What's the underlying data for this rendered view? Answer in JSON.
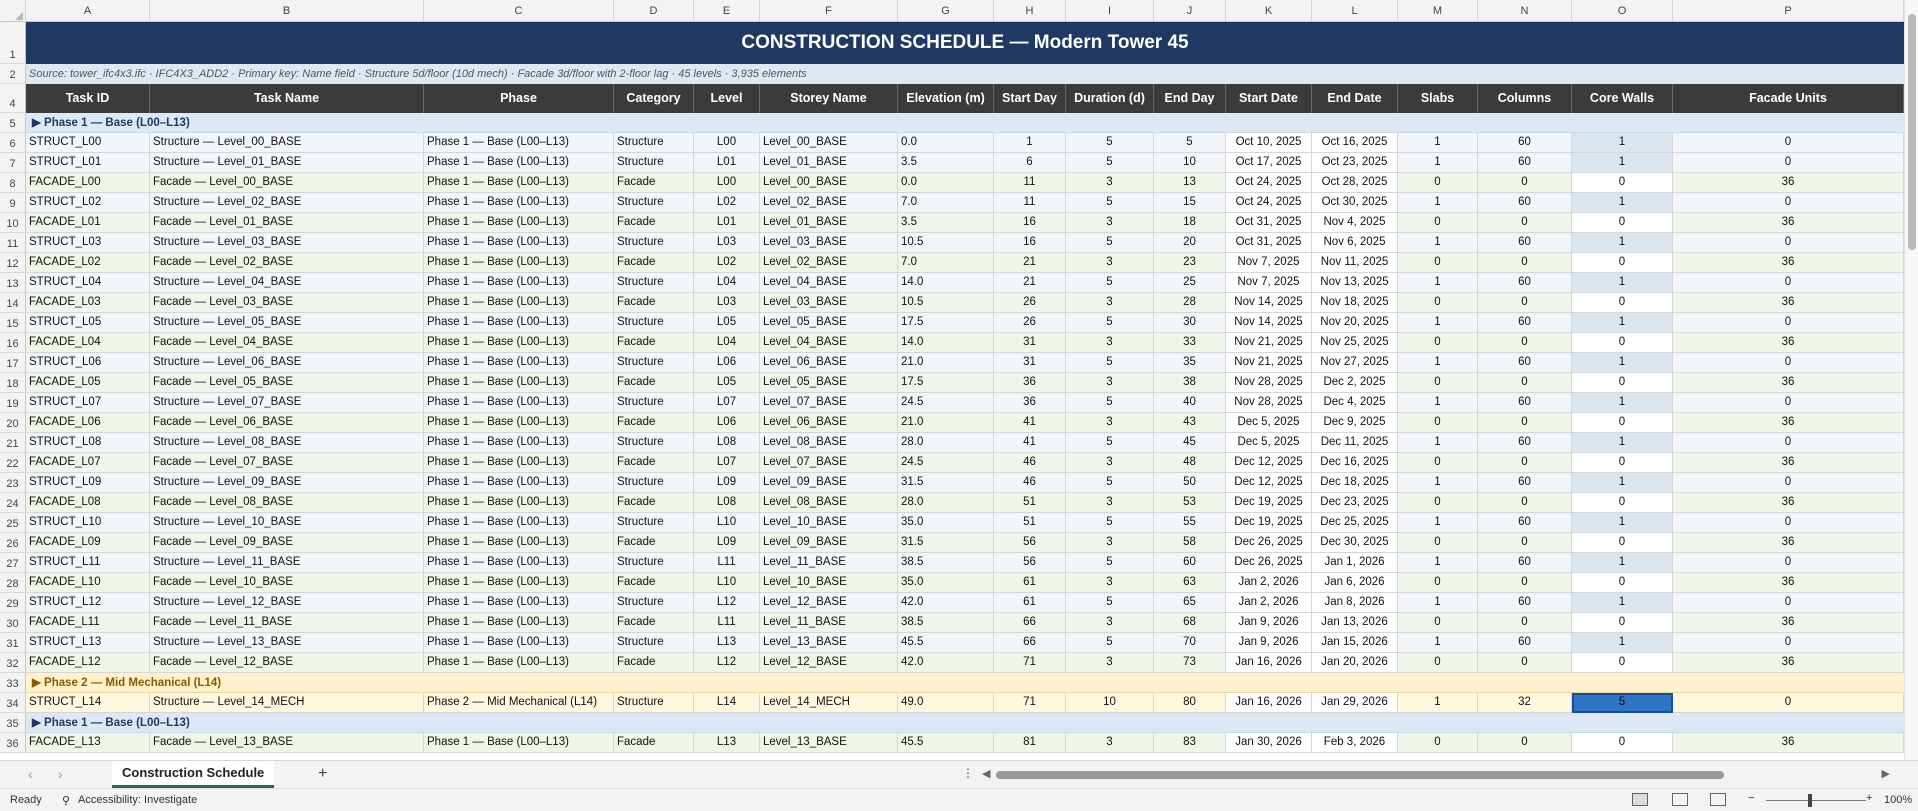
{
  "columns": [
    "A",
    "B",
    "C",
    "D",
    "E",
    "F",
    "G",
    "H",
    "I",
    "J",
    "K",
    "L",
    "M",
    "N",
    "O",
    "P"
  ],
  "title": "CONSTRUCTION SCHEDULE  —  Modern Tower 45",
  "source_line": "Source: tower_ifc4x3.ifc  ·  IFC4X3_ADD2  ·  Primary key: Name field  ·  Structure 5d/floor (10d mech)  ·  Facade 3d/floor with 2-floor lag  ·  45 levels · 3,935 elements",
  "headers": [
    "Task ID",
    "Task Name",
    "Phase",
    "Category",
    "Level",
    "Storey Name",
    "Elevation (m)",
    "Start Day",
    "Duration (d)",
    "End Day",
    "Start Date",
    "End Date",
    "Slabs",
    "Columns",
    "Core Walls",
    "Facade Units"
  ],
  "rows": [
    {
      "n": "1",
      "kind": "title"
    },
    {
      "n": "2",
      "kind": "source"
    },
    {
      "n": "4",
      "kind": "header"
    },
    {
      "n": "5",
      "kind": "phase",
      "cls": "ph1",
      "label": "▶  Phase 1 — Base (L00–L13)"
    },
    {
      "n": "6",
      "kind": "data",
      "cat": "st",
      "cells": [
        "STRUCT_L00",
        "Structure — Level_00_BASE",
        "Phase 1 — Base (L00–L13)",
        "Structure",
        "L00",
        "Level_00_BASE",
        "0.0",
        "1",
        "5",
        "5",
        "Oct 10, 2025",
        "Oct 16, 2025",
        "1",
        "60",
        "1",
        "0"
      ]
    },
    {
      "n": "7",
      "kind": "data",
      "cat": "st",
      "cells": [
        "STRUCT_L01",
        "Structure — Level_01_BASE",
        "Phase 1 — Base (L00–L13)",
        "Structure",
        "L01",
        "Level_01_BASE",
        "3.5",
        "6",
        "5",
        "10",
        "Oct 17, 2025",
        "Oct 23, 2025",
        "1",
        "60",
        "1",
        "0"
      ]
    },
    {
      "n": "8",
      "kind": "data",
      "cat": "fa",
      "cells": [
        "FACADE_L00",
        "Facade — Level_00_BASE",
        "Phase 1 — Base (L00–L13)",
        "Facade",
        "L00",
        "Level_00_BASE",
        "0.0",
        "11",
        "3",
        "13",
        "Oct 24, 2025",
        "Oct 28, 2025",
        "0",
        "0",
        "0",
        "36"
      ]
    },
    {
      "n": "9",
      "kind": "data",
      "cat": "st",
      "cells": [
        "STRUCT_L02",
        "Structure — Level_02_BASE",
        "Phase 1 — Base (L00–L13)",
        "Structure",
        "L02",
        "Level_02_BASE",
        "7.0",
        "11",
        "5",
        "15",
        "Oct 24, 2025",
        "Oct 30, 2025",
        "1",
        "60",
        "1",
        "0"
      ]
    },
    {
      "n": "10",
      "kind": "data",
      "cat": "fa",
      "cells": [
        "FACADE_L01",
        "Facade — Level_01_BASE",
        "Phase 1 — Base (L00–L13)",
        "Facade",
        "L01",
        "Level_01_BASE",
        "3.5",
        "16",
        "3",
        "18",
        "Oct 31, 2025",
        "Nov 4, 2025",
        "0",
        "0",
        "0",
        "36"
      ]
    },
    {
      "n": "11",
      "kind": "data",
      "cat": "st",
      "cells": [
        "STRUCT_L03",
        "Structure — Level_03_BASE",
        "Phase 1 — Base (L00–L13)",
        "Structure",
        "L03",
        "Level_03_BASE",
        "10.5",
        "16",
        "5",
        "20",
        "Oct 31, 2025",
        "Nov 6, 2025",
        "1",
        "60",
        "1",
        "0"
      ]
    },
    {
      "n": "12",
      "kind": "data",
      "cat": "fa",
      "cells": [
        "FACADE_L02",
        "Facade — Level_02_BASE",
        "Phase 1 — Base (L00–L13)",
        "Facade",
        "L02",
        "Level_02_BASE",
        "7.0",
        "21",
        "3",
        "23",
        "Nov 7, 2025",
        "Nov 11, 2025",
        "0",
        "0",
        "0",
        "36"
      ]
    },
    {
      "n": "13",
      "kind": "data",
      "cat": "st",
      "cells": [
        "STRUCT_L04",
        "Structure — Level_04_BASE",
        "Phase 1 — Base (L00–L13)",
        "Structure",
        "L04",
        "Level_04_BASE",
        "14.0",
        "21",
        "5",
        "25",
        "Nov 7, 2025",
        "Nov 13, 2025",
        "1",
        "60",
        "1",
        "0"
      ]
    },
    {
      "n": "14",
      "kind": "data",
      "cat": "fa",
      "cells": [
        "FACADE_L03",
        "Facade — Level_03_BASE",
        "Phase 1 — Base (L00–L13)",
        "Facade",
        "L03",
        "Level_03_BASE",
        "10.5",
        "26",
        "3",
        "28",
        "Nov 14, 2025",
        "Nov 18, 2025",
        "0",
        "0",
        "0",
        "36"
      ]
    },
    {
      "n": "15",
      "kind": "data",
      "cat": "st",
      "cells": [
        "STRUCT_L05",
        "Structure — Level_05_BASE",
        "Phase 1 — Base (L00–L13)",
        "Structure",
        "L05",
        "Level_05_BASE",
        "17.5",
        "26",
        "5",
        "30",
        "Nov 14, 2025",
        "Nov 20, 2025",
        "1",
        "60",
        "1",
        "0"
      ]
    },
    {
      "n": "16",
      "kind": "data",
      "cat": "fa",
      "cells": [
        "FACADE_L04",
        "Facade — Level_04_BASE",
        "Phase 1 — Base (L00–L13)",
        "Facade",
        "L04",
        "Level_04_BASE",
        "14.0",
        "31",
        "3",
        "33",
        "Nov 21, 2025",
        "Nov 25, 2025",
        "0",
        "0",
        "0",
        "36"
      ]
    },
    {
      "n": "17",
      "kind": "data",
      "cat": "st",
      "cells": [
        "STRUCT_L06",
        "Structure — Level_06_BASE",
        "Phase 1 — Base (L00–L13)",
        "Structure",
        "L06",
        "Level_06_BASE",
        "21.0",
        "31",
        "5",
        "35",
        "Nov 21, 2025",
        "Nov 27, 2025",
        "1",
        "60",
        "1",
        "0"
      ]
    },
    {
      "n": "18",
      "kind": "data",
      "cat": "fa",
      "cells": [
        "FACADE_L05",
        "Facade — Level_05_BASE",
        "Phase 1 — Base (L00–L13)",
        "Facade",
        "L05",
        "Level_05_BASE",
        "17.5",
        "36",
        "3",
        "38",
        "Nov 28, 2025",
        "Dec 2, 2025",
        "0",
        "0",
        "0",
        "36"
      ]
    },
    {
      "n": "19",
      "kind": "data",
      "cat": "st",
      "cells": [
        "STRUCT_L07",
        "Structure — Level_07_BASE",
        "Phase 1 — Base (L00–L13)",
        "Structure",
        "L07",
        "Level_07_BASE",
        "24.5",
        "36",
        "5",
        "40",
        "Nov 28, 2025",
        "Dec 4, 2025",
        "1",
        "60",
        "1",
        "0"
      ]
    },
    {
      "n": "20",
      "kind": "data",
      "cat": "fa",
      "cells": [
        "FACADE_L06",
        "Facade — Level_06_BASE",
        "Phase 1 — Base (L00–L13)",
        "Facade",
        "L06",
        "Level_06_BASE",
        "21.0",
        "41",
        "3",
        "43",
        "Dec 5, 2025",
        "Dec 9, 2025",
        "0",
        "0",
        "0",
        "36"
      ]
    },
    {
      "n": "21",
      "kind": "data",
      "cat": "st",
      "cells": [
        "STRUCT_L08",
        "Structure — Level_08_BASE",
        "Phase 1 — Base (L00–L13)",
        "Structure",
        "L08",
        "Level_08_BASE",
        "28.0",
        "41",
        "5",
        "45",
        "Dec 5, 2025",
        "Dec 11, 2025",
        "1",
        "60",
        "1",
        "0"
      ]
    },
    {
      "n": "22",
      "kind": "data",
      "cat": "fa",
      "cells": [
        "FACADE_L07",
        "Facade — Level_07_BASE",
        "Phase 1 — Base (L00–L13)",
        "Facade",
        "L07",
        "Level_07_BASE",
        "24.5",
        "46",
        "3",
        "48",
        "Dec 12, 2025",
        "Dec 16, 2025",
        "0",
        "0",
        "0",
        "36"
      ]
    },
    {
      "n": "23",
      "kind": "data",
      "cat": "st",
      "cells": [
        "STRUCT_L09",
        "Structure — Level_09_BASE",
        "Phase 1 — Base (L00–L13)",
        "Structure",
        "L09",
        "Level_09_BASE",
        "31.5",
        "46",
        "5",
        "50",
        "Dec 12, 2025",
        "Dec 18, 2025",
        "1",
        "60",
        "1",
        "0"
      ]
    },
    {
      "n": "24",
      "kind": "data",
      "cat": "fa",
      "cells": [
        "FACADE_L08",
        "Facade — Level_08_BASE",
        "Phase 1 — Base (L00–L13)",
        "Facade",
        "L08",
        "Level_08_BASE",
        "28.0",
        "51",
        "3",
        "53",
        "Dec 19, 2025",
        "Dec 23, 2025",
        "0",
        "0",
        "0",
        "36"
      ]
    },
    {
      "n": "25",
      "kind": "data",
      "cat": "st",
      "cells": [
        "STRUCT_L10",
        "Structure — Level_10_BASE",
        "Phase 1 — Base (L00–L13)",
        "Structure",
        "L10",
        "Level_10_BASE",
        "35.0",
        "51",
        "5",
        "55",
        "Dec 19, 2025",
        "Dec 25, 2025",
        "1",
        "60",
        "1",
        "0"
      ]
    },
    {
      "n": "26",
      "kind": "data",
      "cat": "fa",
      "cells": [
        "FACADE_L09",
        "Facade — Level_09_BASE",
        "Phase 1 — Base (L00–L13)",
        "Facade",
        "L09",
        "Level_09_BASE",
        "31.5",
        "56",
        "3",
        "58",
        "Dec 26, 2025",
        "Dec 30, 2025",
        "0",
        "0",
        "0",
        "36"
      ]
    },
    {
      "n": "27",
      "kind": "data",
      "cat": "st",
      "cells": [
        "STRUCT_L11",
        "Structure — Level_11_BASE",
        "Phase 1 — Base (L00–L13)",
        "Structure",
        "L11",
        "Level_11_BASE",
        "38.5",
        "56",
        "5",
        "60",
        "Dec 26, 2025",
        "Jan 1, 2026",
        "1",
        "60",
        "1",
        "0"
      ]
    },
    {
      "n": "28",
      "kind": "data",
      "cat": "fa",
      "cells": [
        "FACADE_L10",
        "Facade — Level_10_BASE",
        "Phase 1 — Base (L00–L13)",
        "Facade",
        "L10",
        "Level_10_BASE",
        "35.0",
        "61",
        "3",
        "63",
        "Jan 2, 2026",
        "Jan 6, 2026",
        "0",
        "0",
        "0",
        "36"
      ]
    },
    {
      "n": "29",
      "kind": "data",
      "cat": "st",
      "cells": [
        "STRUCT_L12",
        "Structure — Level_12_BASE",
        "Phase 1 — Base (L00–L13)",
        "Structure",
        "L12",
        "Level_12_BASE",
        "42.0",
        "61",
        "5",
        "65",
        "Jan 2, 2026",
        "Jan 8, 2026",
        "1",
        "60",
        "1",
        "0"
      ]
    },
    {
      "n": "30",
      "kind": "data",
      "cat": "fa",
      "cells": [
        "FACADE_L11",
        "Facade — Level_11_BASE",
        "Phase 1 — Base (L00–L13)",
        "Facade",
        "L11",
        "Level_11_BASE",
        "38.5",
        "66",
        "3",
        "68",
        "Jan 9, 2026",
        "Jan 13, 2026",
        "0",
        "0",
        "0",
        "36"
      ]
    },
    {
      "n": "31",
      "kind": "data",
      "cat": "st",
      "cells": [
        "STRUCT_L13",
        "Structure — Level_13_BASE",
        "Phase 1 — Base (L00–L13)",
        "Structure",
        "L13",
        "Level_13_BASE",
        "45.5",
        "66",
        "5",
        "70",
        "Jan 9, 2026",
        "Jan 15, 2026",
        "1",
        "60",
        "1",
        "0"
      ]
    },
    {
      "n": "32",
      "kind": "data",
      "cat": "fa",
      "cells": [
        "FACADE_L12",
        "Facade — Level_12_BASE",
        "Phase 1 — Base (L00–L13)",
        "Facade",
        "L12",
        "Level_12_BASE",
        "42.0",
        "71",
        "3",
        "73",
        "Jan 16, 2026",
        "Jan 20, 2026",
        "0",
        "0",
        "0",
        "36"
      ]
    },
    {
      "n": "33",
      "kind": "phase",
      "cls": "ph2",
      "label": "▶  Phase 2 — Mid Mechanical (L14)"
    },
    {
      "n": "34",
      "kind": "data",
      "cat": "mech",
      "sel": true,
      "cells": [
        "STRUCT_L14",
        "Structure — Level_14_MECH",
        "Phase 2 — Mid Mechanical (L14)",
        "Structure",
        "L14",
        "Level_14_MECH",
        "49.0",
        "71",
        "10",
        "80",
        "Jan 16, 2026",
        "Jan 29, 2026",
        "1",
        "32",
        "5",
        "0"
      ]
    },
    {
      "n": "35",
      "kind": "phase",
      "cls": "ph1",
      "label": "▶  Phase 1 — Base (L00–L13)"
    },
    {
      "n": "36",
      "kind": "data",
      "cat": "fa",
      "cells": [
        "FACADE_L13",
        "Facade — Level_13_BASE",
        "Phase 1 — Base (L00–L13)",
        "Facade",
        "L13",
        "Level_13_BASE",
        "45.5",
        "81",
        "3",
        "83",
        "Jan 30, 2026",
        "Feb 3, 2026",
        "0",
        "0",
        "0",
        "36"
      ]
    }
  ],
  "sheet_tab": "Construction Schedule",
  "status": {
    "ready": "Ready",
    "accessibility": "Accessibility: Investigate",
    "zoom": "100%"
  }
}
